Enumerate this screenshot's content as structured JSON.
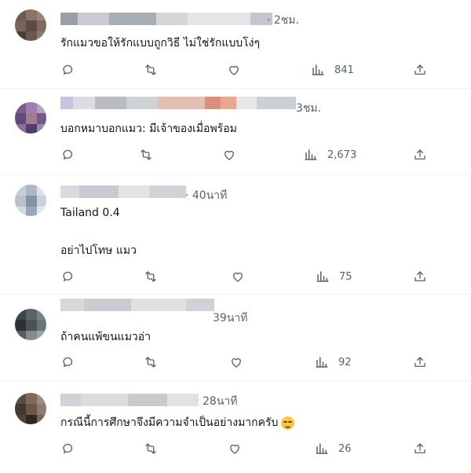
{
  "posts": [
    {
      "time": "· 2ชม.",
      "text": "รักแมวขอให้รักแบบถูกวิธี ไม่ใช่รักแบบโง่ๆ",
      "text2": "",
      "emoji": "",
      "views": "841"
    },
    {
      "time": "3ชม.",
      "text": "บอกหมาบอกแมว: มีเจ้าของเมื่อพร้อม",
      "text2": "",
      "emoji": "",
      "views": "2,673"
    },
    {
      "time": "· 40นาที",
      "text": "Tailand 0.4",
      "text2": "อย่าไปโทษ แมว",
      "emoji": "",
      "views": "75"
    },
    {
      "time": "39นาที",
      "text": "ถ้าคนแพ้ขนแมวอ่า",
      "text2": "",
      "emoji": "",
      "views": "92"
    },
    {
      "time": "28นาที",
      "text": "กรณีนี้การศึกษาจึงมีความจำเป็นอย่างมากครับ",
      "text2": "",
      "emoji": "smirking-face",
      "views": "26"
    }
  ],
  "colors": {
    "icon": "#536471",
    "text": "#0f1419",
    "divider": "#eff3f4"
  }
}
